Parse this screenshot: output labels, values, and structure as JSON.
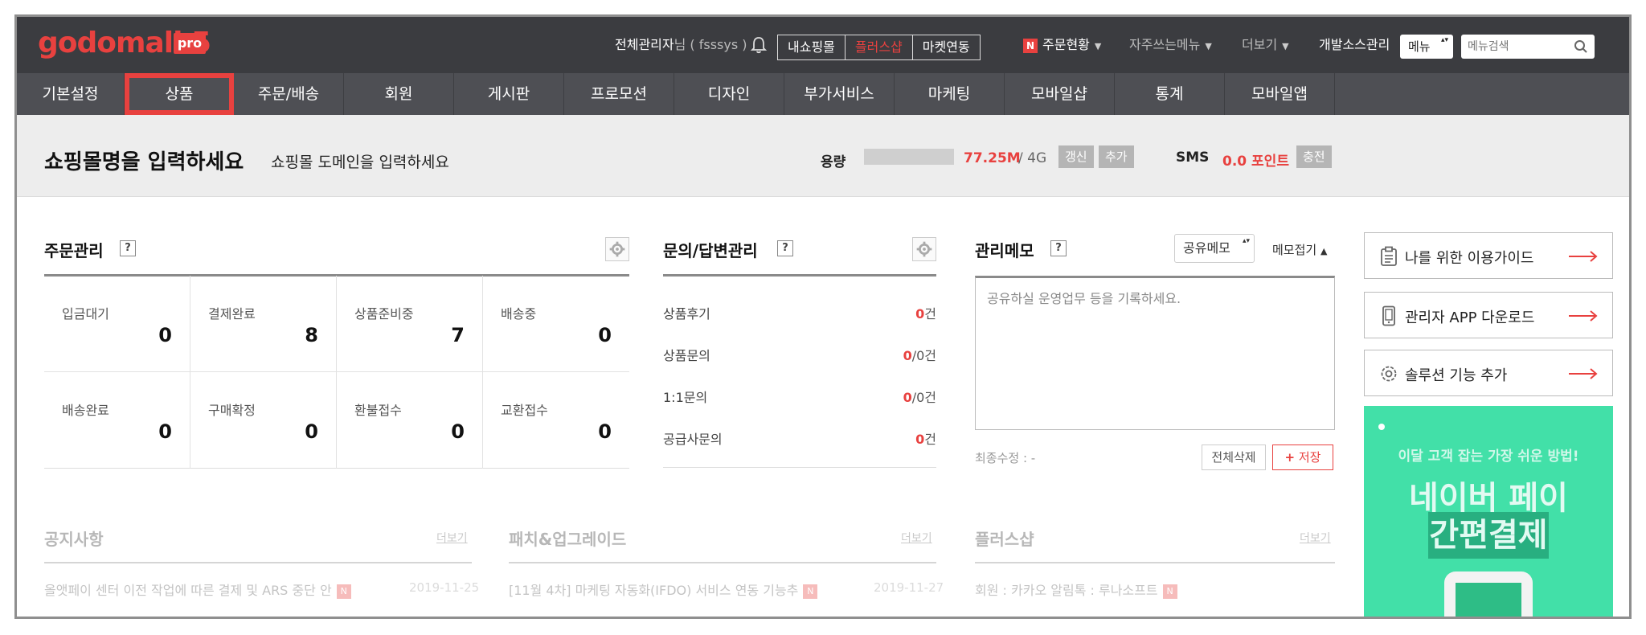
{
  "brand": {
    "logo": "godomall 5",
    "badge": "pro"
  },
  "topbar": {
    "admin": "전체관리자",
    "admin_suffix": "님 ( fsssys )",
    "seg": [
      "내쇼핑몰",
      "플러스샵",
      "마켓연동"
    ],
    "order_status": "주문현황",
    "favorites": "자주쓰는메뉴",
    "more": "더보기",
    "dev": "개발소스관리",
    "menu_select": "메뉴",
    "search_placeholder": "메뉴검색"
  },
  "nav": [
    "기본설정",
    "상품",
    "주문/배송",
    "회원",
    "게시판",
    "프로모션",
    "디자인",
    "부가서비스",
    "마케팅",
    "모바일샵",
    "통계",
    "모바일앱"
  ],
  "header": {
    "title": "쇼핑몰명을 입력하세요",
    "domain": "쇼핑몰 도메인을 입력하세요",
    "capacity_label": "용량",
    "capacity_used": "77.25M",
    "capacity_total": "/ 4G",
    "refresh": "갱신",
    "add": "추가",
    "sms_label": "SMS",
    "sms_points": "0.0 포인트",
    "charge": "충전"
  },
  "orders": {
    "title": "주문관리",
    "help": "?",
    "cells": [
      {
        "label": "입금대기",
        "value": "0"
      },
      {
        "label": "결제완료",
        "value": "8"
      },
      {
        "label": "상품준비중",
        "value": "7"
      },
      {
        "label": "배송중",
        "value": "0"
      },
      {
        "label": "배송완료",
        "value": "0"
      },
      {
        "label": "구매확정",
        "value": "0"
      },
      {
        "label": "환불접수",
        "value": "0"
      },
      {
        "label": "교환접수",
        "value": "0"
      }
    ]
  },
  "qa": {
    "title": "문의/답변관리",
    "help": "?",
    "rows": [
      {
        "label": "상품후기",
        "red": "0",
        "rest": "건"
      },
      {
        "label": "상품문의",
        "red": "0",
        "rest": "/0건"
      },
      {
        "label": "1:1문의",
        "red": "0",
        "rest": "/0건"
      },
      {
        "label": "공급사문의",
        "red": "0",
        "rest": "건"
      }
    ]
  },
  "memo": {
    "title": "관리메모",
    "help": "?",
    "share_select": "공유메모",
    "collapse": "메모접기",
    "placeholder": "공유하실 운영업무 등을 기록하세요.",
    "last_edit": "최종수정 : -",
    "delete_all": "전체삭제",
    "save": "저장"
  },
  "side": {
    "guide": "나를 위한 이용가이드",
    "app": "관리자 APP 다운로드",
    "solution": "솔루션 기능 추가",
    "banner_sub": "이달 고객 잡는 가장 쉬운 방법!",
    "banner_main": "네이버 페이",
    "banner_main2": "간편결제"
  },
  "bottom": {
    "notice_title": "공지사항",
    "patch_title": "패치&업그레이드",
    "plus_title": "플러스샵",
    "more": "더보기",
    "notice_1": "올앳페이 센터 이전 작업에 따른 결제 및 ARS 중단 안",
    "notice_1_date": "2019-11-25",
    "patch_1": "[11월 4차] 마케팅 자동화(IFDO) 서비스 연동 기능추",
    "patch_1_date": "2019-11-27",
    "plus_1": "회원 : 카카오 알림톡 : 루나소프트",
    "new_badge": "N"
  },
  "colors": {
    "accent": "#e8413f",
    "topbar": "#3b3c40",
    "nav": "#4e4f54",
    "banner": "#42e0a8"
  }
}
